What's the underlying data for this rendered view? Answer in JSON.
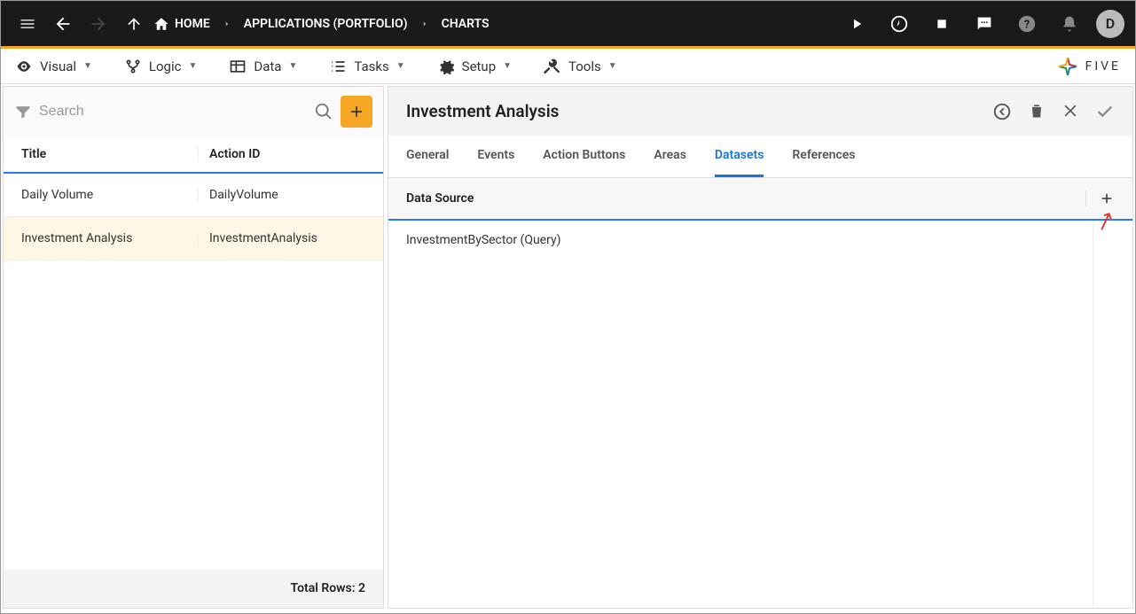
{
  "topbar": {
    "breadcrumb": {
      "home": "HOME",
      "applications": "APPLICATIONS (PORTFOLIO)",
      "charts": "CHARTS"
    },
    "avatar": "D"
  },
  "menubar": {
    "visual": "Visual",
    "logic": "Logic",
    "data": "Data",
    "tasks": "Tasks",
    "setup": "Setup",
    "tools": "Tools",
    "logo": "FIVE"
  },
  "leftpanel": {
    "search_placeholder": "Search",
    "columns": {
      "title": "Title",
      "action_id": "Action ID"
    },
    "rows": [
      {
        "title": "Daily Volume",
        "action_id": "DailyVolume"
      },
      {
        "title": "Investment Analysis",
        "action_id": "InvestmentAnalysis"
      }
    ],
    "total_label": "Total Rows: 2"
  },
  "detail": {
    "title": "Investment Analysis",
    "tabs": {
      "general": "General",
      "events": "Events",
      "action_buttons": "Action Buttons",
      "areas": "Areas",
      "datasets": "Datasets",
      "references": "References"
    },
    "datasource_label": "Data Source",
    "datasource_items": [
      "InvestmentBySector (Query)"
    ]
  }
}
